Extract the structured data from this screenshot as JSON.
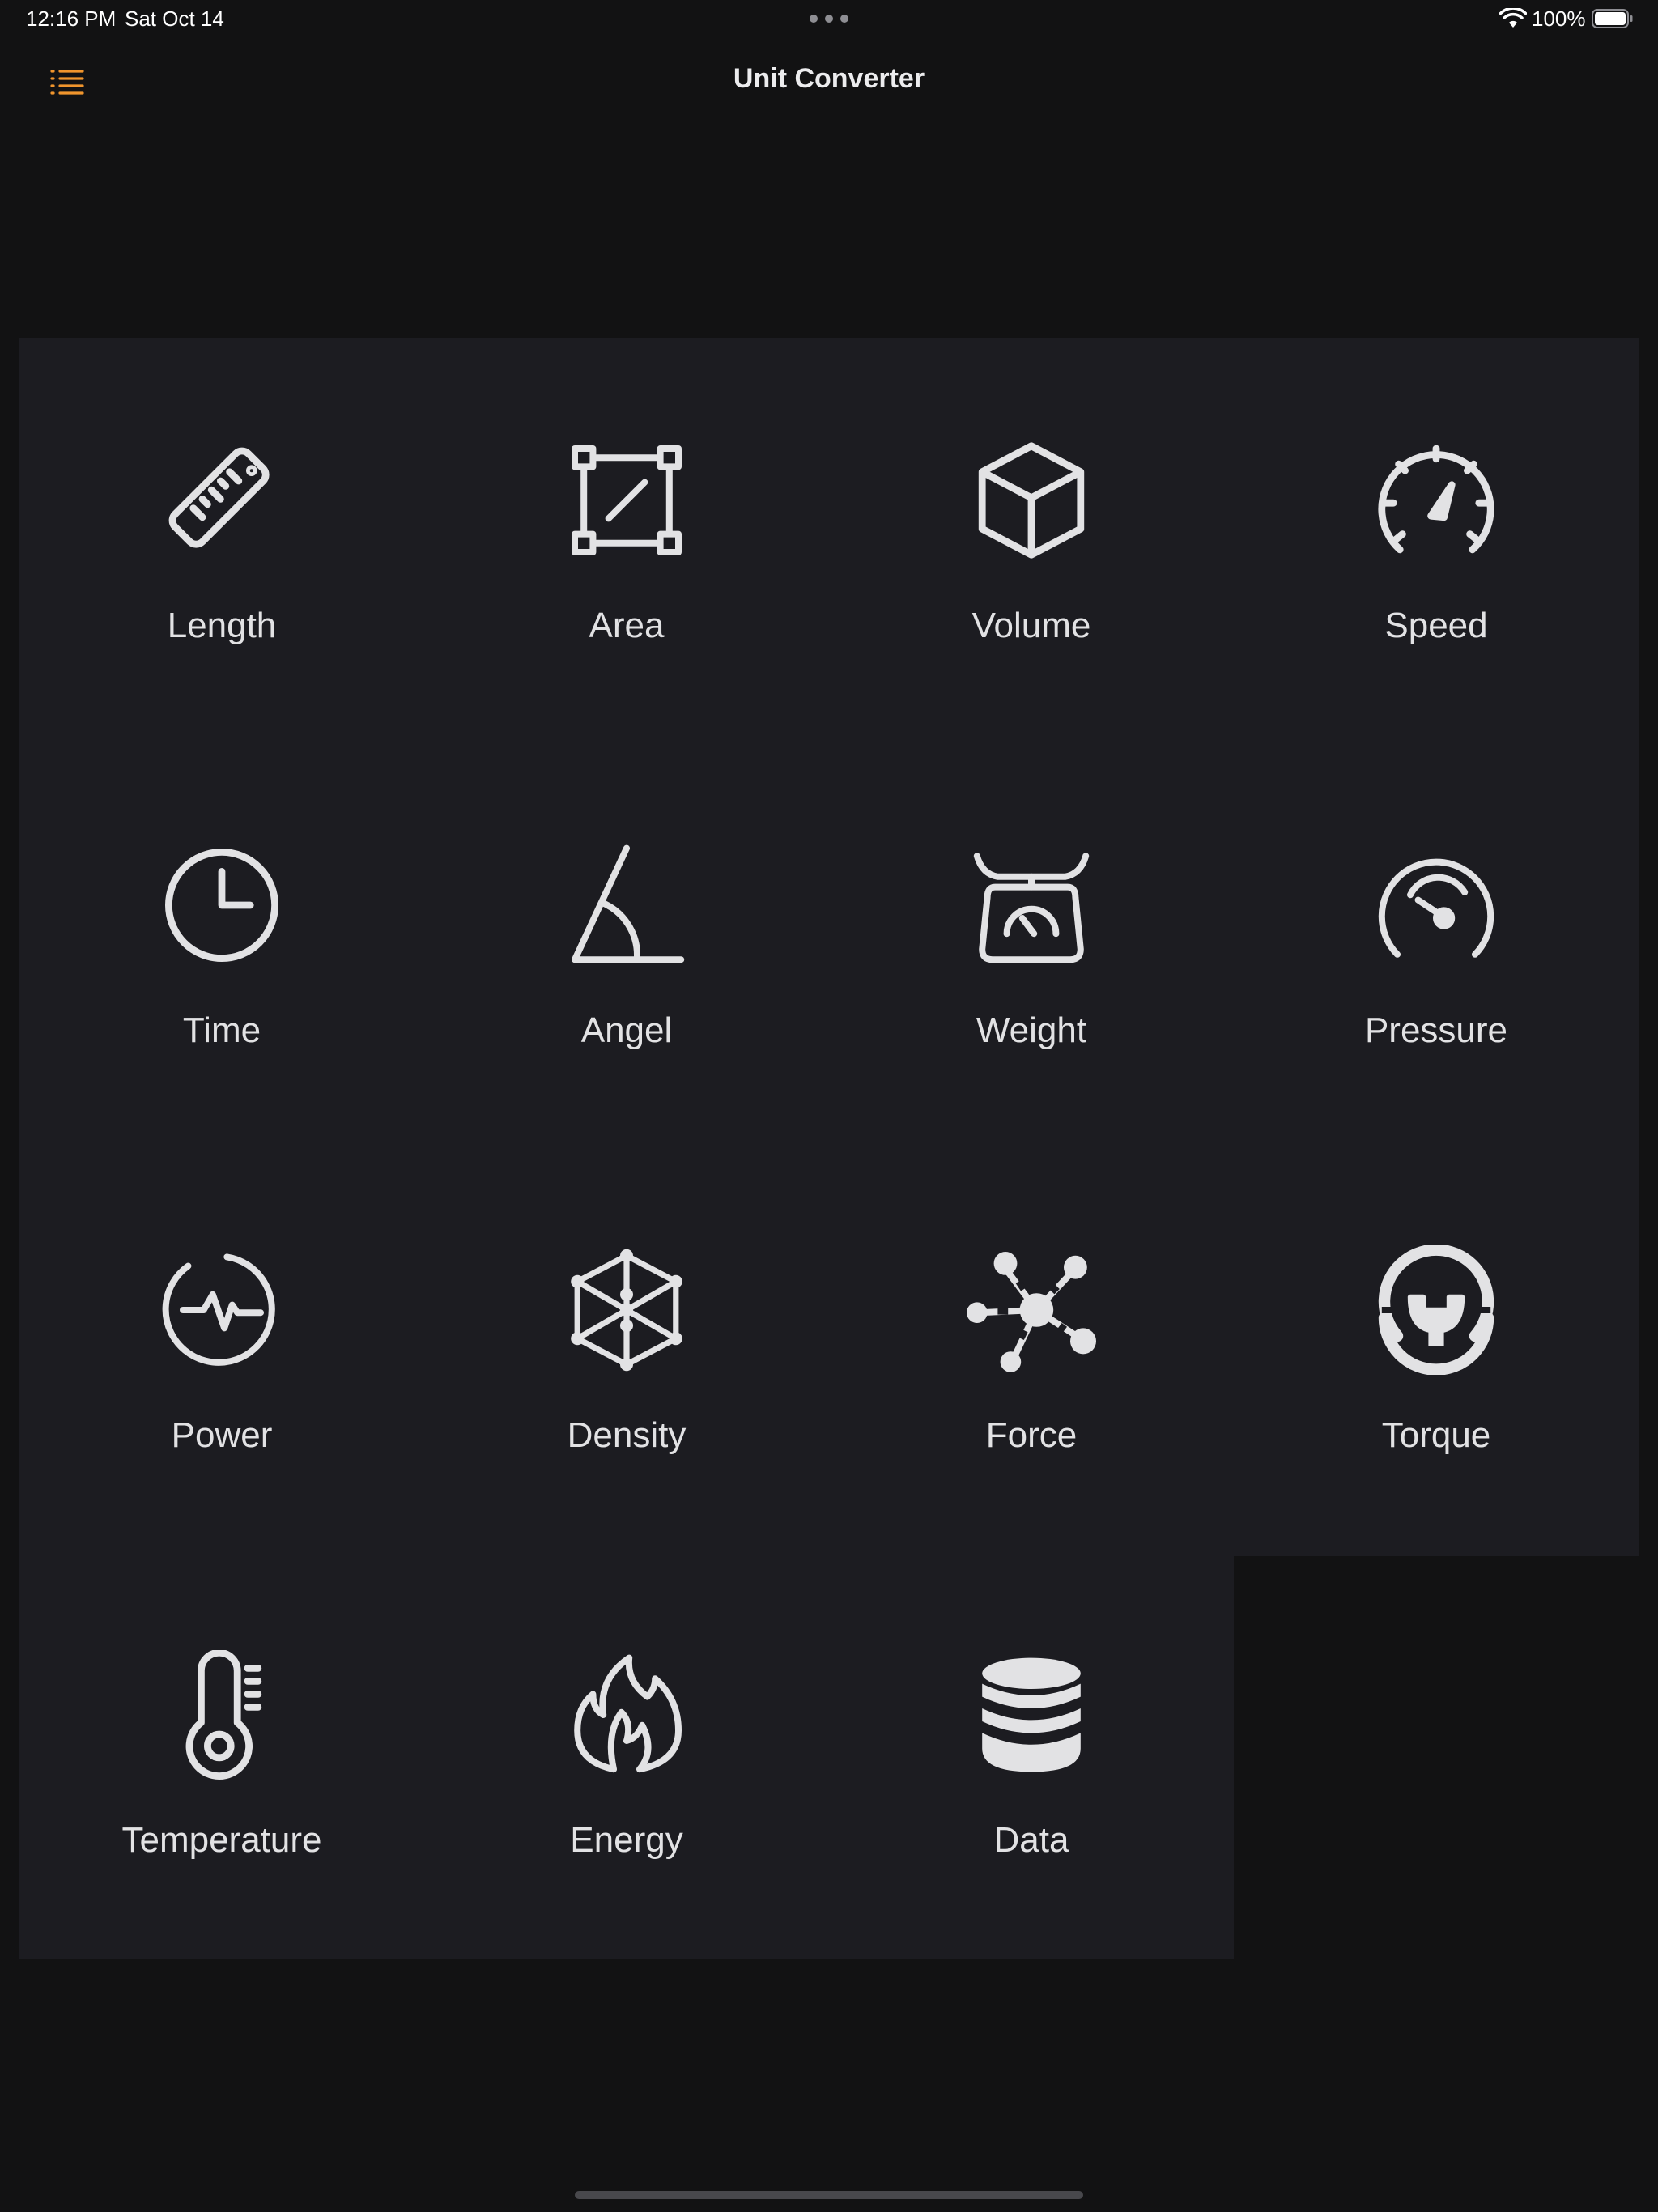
{
  "status_bar": {
    "time": "12:16 PM",
    "date": "Sat Oct 14",
    "battery": "100%",
    "wifi_icon": "wifi-icon",
    "battery_icon": "battery-full-icon",
    "multitask_icon": "more-dots-icon"
  },
  "nav": {
    "title": "Unit Converter",
    "menu_icon": "list-icon",
    "accent_color": "#f0952d"
  },
  "categories": [
    {
      "label": "Length",
      "icon": "ruler-icon"
    },
    {
      "label": "Area",
      "icon": "area-square-icon"
    },
    {
      "label": "Volume",
      "icon": "cube-icon"
    },
    {
      "label": "Speed",
      "icon": "speedometer-icon"
    },
    {
      "label": "Time",
      "icon": "clock-icon"
    },
    {
      "label": "Angel",
      "icon": "angle-icon"
    },
    {
      "label": "Weight",
      "icon": "scale-icon"
    },
    {
      "label": "Pressure",
      "icon": "gauge-icon"
    },
    {
      "label": "Power",
      "icon": "power-pulse-icon"
    },
    {
      "label": "Density",
      "icon": "density-cube-icon"
    },
    {
      "label": "Force",
      "icon": "force-network-icon"
    },
    {
      "label": "Torque",
      "icon": "torque-wrench-icon"
    },
    {
      "label": "Temperature",
      "icon": "thermometer-icon"
    },
    {
      "label": "Energy",
      "icon": "flame-icon"
    },
    {
      "label": "Data",
      "icon": "database-icon"
    }
  ],
  "colors": {
    "background": "#121213",
    "panel": "#1c1c21",
    "icon": "#e2e2e4"
  }
}
